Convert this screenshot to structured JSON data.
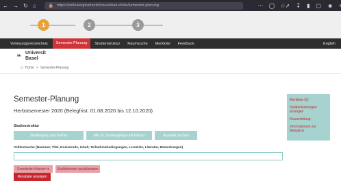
{
  "browser": {
    "url": "https://vorlesungsverzeichnis.unibas.ch/de/semester-planung",
    "nav_icons": [
      "back-icon",
      "forward-icon",
      "reload-icon",
      "home-icon"
    ],
    "menu_icon_glyph": "⋯"
  },
  "progress": {
    "steps": [
      {
        "label": "1",
        "state": "active"
      },
      {
        "label": "2",
        "state": "inactive"
      },
      {
        "label": "3",
        "state": "inactive"
      }
    ],
    "active_color": "#e8a23a",
    "inactive_color": "#9a9a9a"
  },
  "mainnav": {
    "items": [
      "Vorlesungsverzeichnis",
      "Semester-Planung",
      "Studienstruktur",
      "Raumsuche",
      "Merkliste",
      "Feedback"
    ],
    "active_index": 1,
    "language": "English"
  },
  "logo": {
    "line1": "Universit",
    "line2": "Basel"
  },
  "breadcrumb": {
    "home": "Home",
    "sep": ">",
    "current": "Semester-Planung"
  },
  "page": {
    "title": "Semester-Planung",
    "subtitle": "Herbstsemester 2020 (Belegfrist: 01.08.2020 bis 12.10.2020)",
    "section_label": "Studienstruktur",
    "structure_buttons": [
      "Studiengang und Fächer",
      "Alle St. Studiengänge und Fächer",
      "Auswahl loschen"
    ],
    "search_label": "Volltextsuche (Nummer, Titel, Dozierende, Inhalt, Teilnahmebedingungen, Lernziele, Literatur, Bemerkungen)",
    "search_value": "",
    "search_placeholder": "",
    "filter_buttons": [
      "Erweiterte Kriterien ▾",
      "Suchkriterien zurücksetzen"
    ],
    "results_button": "Resultate anzeigen"
  },
  "sidebar": {
    "items": [
      "Merkliste (0)",
      "Studienleistungen anzeigen",
      "Kurzanleitung",
      "Informationen zur Belegfrist"
    ]
  },
  "colors": {
    "accent_red": "#c7262f",
    "teal": "#a6d3cf",
    "nav_dark": "#2e2e2e"
  }
}
